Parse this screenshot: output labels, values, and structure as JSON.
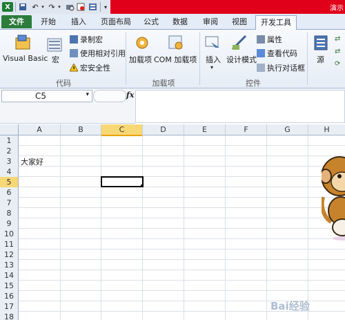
{
  "window": {
    "title_fragment": "演示"
  },
  "ribbon_tabs": [
    "文件",
    "开始",
    "插入",
    "页面布局",
    "公式",
    "数据",
    "审阅",
    "视图",
    "开发工具"
  ],
  "active_tab": "开发工具",
  "ribbon": {
    "code_group": {
      "label": "代码",
      "visual_basic": "Visual Basic",
      "macros": "宏",
      "record_macro": "录制宏",
      "use_relative": "使用相对引用",
      "macro_security": "宏安全性"
    },
    "addins_group": {
      "label": "加载项",
      "addins": "加载项",
      "com_addins": "COM 加载项"
    },
    "controls_group": {
      "label": "控件",
      "insert": "插入",
      "design_mode": "设计模式",
      "properties": "属性",
      "view_code": "查看代码",
      "run_dialog": "执行对话框"
    },
    "xml_group": {
      "source": "源"
    }
  },
  "formula_bar": {
    "name_box": "C5",
    "fx": "fx",
    "formula": ""
  },
  "sheet": {
    "columns": [
      "A",
      "B",
      "C",
      "D",
      "E",
      "F",
      "G",
      "H"
    ],
    "rows": [
      "1",
      "2",
      "3",
      "4",
      "5",
      "6",
      "7",
      "8",
      "9",
      "10",
      "11",
      "12",
      "13",
      "14",
      "15",
      "16",
      "17",
      "18"
    ],
    "selected_column": "C",
    "selected_row": "5",
    "cells": {
      "A3": "大家好"
    }
  },
  "watermark": "Bai经验",
  "colors": {
    "file_tab": "#2c7c3c",
    "selection_header": "#f8d775",
    "title_accent": "#e0001a"
  }
}
